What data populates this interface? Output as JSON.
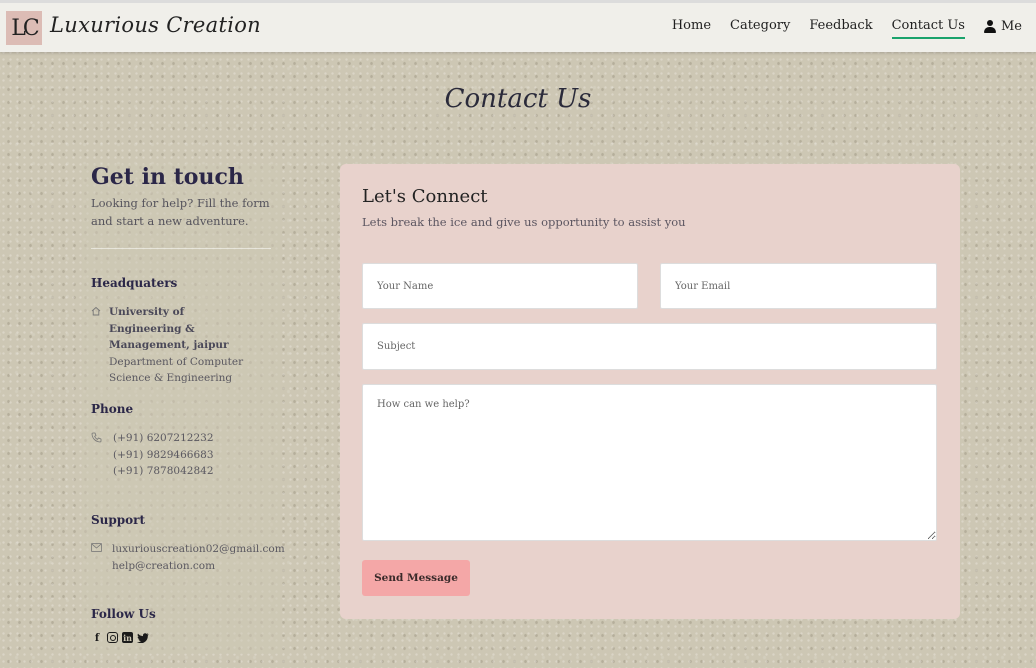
{
  "navbar": {
    "logo_text": "LC",
    "brand": "Luxurious Creation",
    "links": [
      {
        "label": "Home",
        "active": false
      },
      {
        "label": "Category",
        "active": false
      },
      {
        "label": "Feedback",
        "active": false
      },
      {
        "label": "Contact Us",
        "active": true
      }
    ],
    "user_label": "Me",
    "active_color": "#1aa36c"
  },
  "page_title": "Contact Us",
  "info": {
    "title": "Get in touch",
    "lead": "Looking for help? Fill the form and start a new adventure.",
    "headquarters": {
      "heading": "Headquaters",
      "line1": "University of Engineering & Management, jaipur",
      "line2": "Department of Computer Science & Engineering"
    },
    "phone": {
      "heading": "Phone",
      "numbers": [
        "(+91) 6207212232",
        "(+91) 9829466683",
        "(+91) 7878042842"
      ]
    },
    "support": {
      "heading": "Support",
      "emails": [
        "luxuriouscreation02@gmail.com",
        "help@creation.com"
      ]
    },
    "follow": {
      "heading": "Follow Us",
      "icons": [
        "facebook-icon",
        "instagram-icon",
        "linkedin-icon",
        "twitter-icon"
      ]
    }
  },
  "form": {
    "title": "Let's Connect",
    "subtitle": "Lets break the ice and give us opportunity to assist you",
    "name_placeholder": "Your Name",
    "email_placeholder": "Your Email",
    "subject_placeholder": "Subject",
    "message_placeholder": "How can we help?",
    "send_label": "Send Message",
    "card_color": "#e8d2cc",
    "button_color": "#f4a7a7"
  }
}
